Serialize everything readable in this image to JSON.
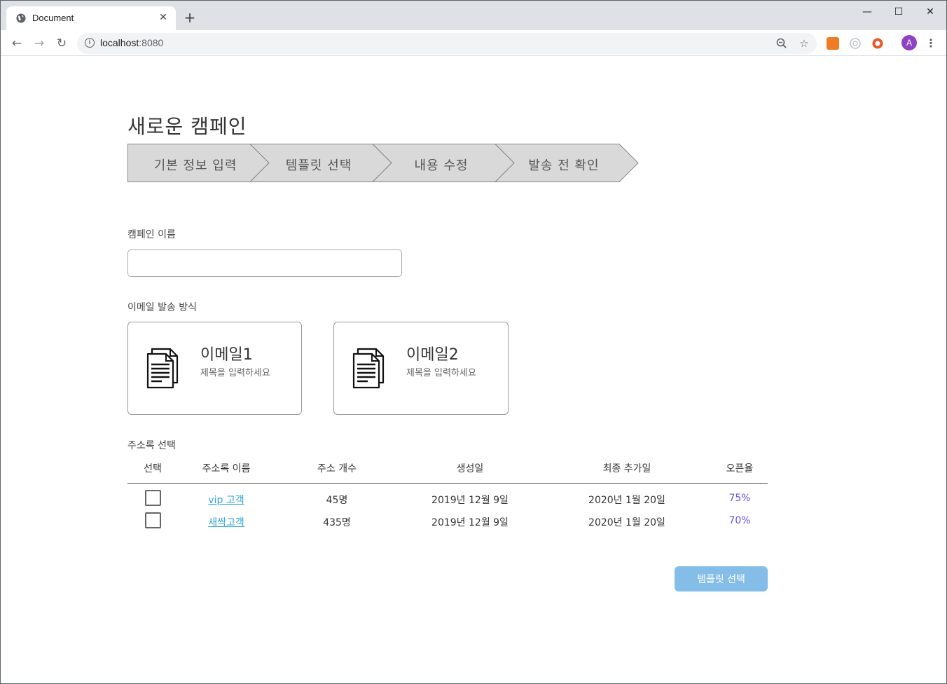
{
  "browser": {
    "tab_title": "Document",
    "url_host": "localhost",
    "url_port": ":8080",
    "close_glyph": "✕",
    "newtab_glyph": "+",
    "back_glyph": "←",
    "forward_glyph": "→",
    "reload_glyph": "↻",
    "info_glyph": "i",
    "zoom_glyph": "🔍",
    "star_glyph": "☆",
    "avatar_letter": "A",
    "menu_glyph": "⋮",
    "win_min": "—",
    "win_max": "☐",
    "win_close": "✕"
  },
  "page": {
    "title": "새로운 캠페인",
    "steps": [
      "기본 정보 입력",
      "템플릿 선택",
      "내용 수정",
      "발송 전 확인"
    ],
    "campaign_name_label": "캠페인 이름",
    "campaign_name_value": "",
    "send_method_label": "이메일 발송 방식",
    "email_cards": [
      {
        "title": "이메일1",
        "subtitle": "제목을 입력하세요"
      },
      {
        "title": "이메일2",
        "subtitle": "제목을 입력하세요"
      }
    ],
    "address_book_label": "주소록 선택",
    "table": {
      "headers": [
        "선택",
        "주소록 이름",
        "주소 개수",
        "생성일",
        "최종 추가일",
        "오픈율"
      ],
      "rows": [
        {
          "name": "vip 고객",
          "count": "45명",
          "created": "2019년 12월 9일",
          "last_added": "2020년 1월 20일",
          "open_rate": "75%"
        },
        {
          "name": "새싹고객",
          "count": "435명",
          "created": "2019년 12월 9일",
          "last_added": "2020년 1월 20일",
          "open_rate": "70%"
        }
      ]
    },
    "next_button": "템플릿 선택"
  },
  "colors": {
    "step_fill": "#d9d9d9",
    "link": "#2aa4dc",
    "rate": "#6b4fe0",
    "button": "#85bde9"
  }
}
